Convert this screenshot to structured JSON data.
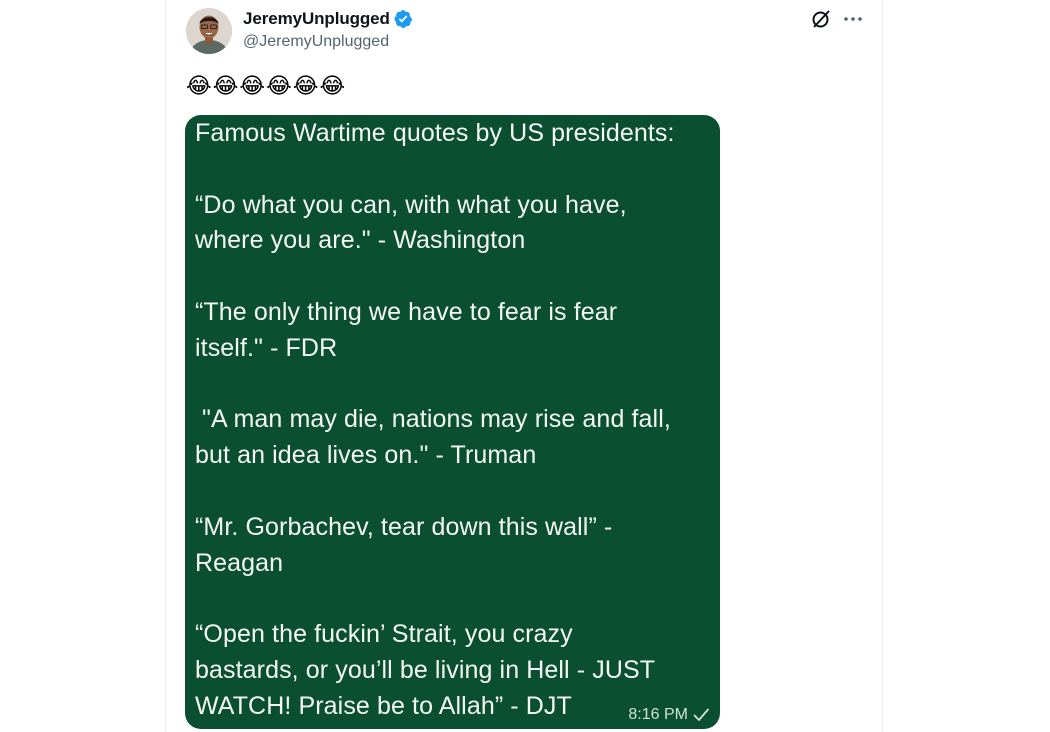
{
  "author": {
    "display_name": "JeremyUnplugged",
    "handle": "@JeremyUnplugged",
    "verified": true,
    "avatar": "profile-photo"
  },
  "actions": {
    "grok_icon": "grok-icon",
    "more_icon": "more-options-icon"
  },
  "tweet": {
    "text": "😂😂😂😂😂😂"
  },
  "media": {
    "type": "chat-message-screenshot",
    "background_color": "#0b4f32",
    "lines": [
      "Famous Wartime quotes by US presidents:",
      "",
      "“Do what you can, with what you have,",
      "where you are.\" - Washington",
      "",
      "“The only thing we have to fear is fear",
      "itself.\" - FDR",
      "",
      " \"A man may die, nations may rise and fall,",
      "but an idea lives on.\" - Truman",
      "",
      "“Mr. Gorbachev, tear down this wall” -",
      "Reagan",
      "",
      "“Open the fuckin’ Strait, you crazy",
      "bastards, or you’ll be living in Hell - JUST",
      "WATCH! Praise be to Allah” - DJT"
    ],
    "timestamp": "8:16 PM",
    "status_icon": "checkmark-icon"
  }
}
